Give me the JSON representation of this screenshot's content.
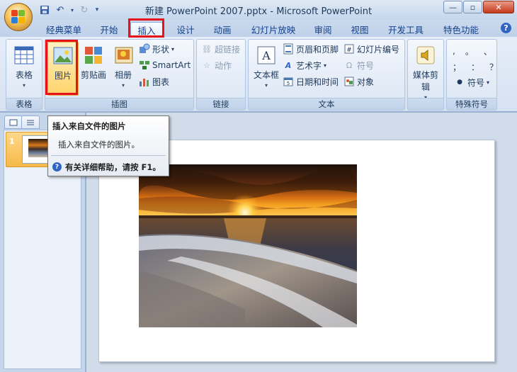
{
  "window": {
    "title": "新建 PowerPoint 2007.pptx - Microsoft PowerPoint",
    "minimize": "—",
    "maximize": "▫",
    "close": "✕"
  },
  "quick_access": {
    "save_icon": "save-icon",
    "undo_icon": "undo-icon",
    "redo_icon": "redo-icon"
  },
  "tabs": [
    {
      "label": "经典菜单"
    },
    {
      "label": "开始"
    },
    {
      "label": "插入",
      "active": true
    },
    {
      "label": "设计"
    },
    {
      "label": "动画"
    },
    {
      "label": "幻灯片放映"
    },
    {
      "label": "审阅"
    },
    {
      "label": "视图"
    },
    {
      "label": "开发工具"
    },
    {
      "label": "特色功能"
    }
  ],
  "ribbon": {
    "table_group": {
      "label": "表格",
      "table_button": "表格"
    },
    "illustrations_group": {
      "label": "插图",
      "picture_button": "图片",
      "clipart_button": "剪贴画",
      "album_button": "相册",
      "shapes_button": "形状",
      "smartart_button": "SmartArt",
      "chart_button": "图表"
    },
    "links_group": {
      "label": "链接",
      "hyperlink_button": "超链接",
      "action_button": "动作"
    },
    "text_group": {
      "label": "文本",
      "textbox_button": "文本框",
      "header_footer_button": "页眉和页脚",
      "wordart_button": "艺术字",
      "datetime_button": "日期和时间",
      "slide_number_button": "幻灯片编号",
      "symbol_button": "符号",
      "object_button": "对象"
    },
    "media_group": {
      "label": "",
      "media_button": "媒体剪辑"
    },
    "special_symbols_group": {
      "label": "特殊符号",
      "symbols_row1": [
        ",",
        "。",
        "、"
      ],
      "symbols_row2": [
        "；",
        "：",
        "？"
      ],
      "symbol_button": "符号"
    }
  },
  "slides_pane": {
    "slide_number": "1"
  },
  "tooltip": {
    "title": "插入来自文件的图片",
    "description": "插入来自文件的图片。",
    "help": "有关详细帮助，请按 F1。"
  },
  "colors": {
    "highlight": "#e8121b",
    "ribbon_bg": "#dfe8f5",
    "selected_thumb": "#f6b94a"
  }
}
